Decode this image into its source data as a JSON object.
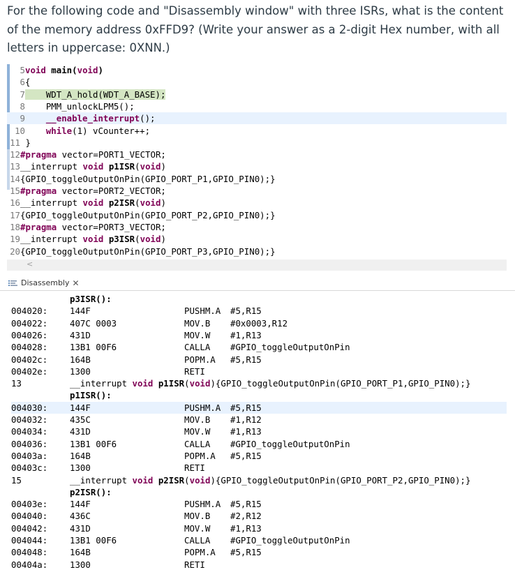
{
  "question": "For the following code and \"Disassembly window\" with three ISRs, what is the content of the memory address 0xFFD9? (Write your answer as a 2-digit Hex number, with all letters in uppercase: 0XNN.)",
  "editor": {
    "lines": [
      {
        "num": "5",
        "segments": [
          {
            "t": "void",
            "k": true
          },
          {
            "t": " main(",
            "k": false,
            "b": true
          },
          {
            "t": "void",
            "k": true
          },
          {
            "t": ")",
            "k": false,
            "b": true
          }
        ],
        "hl": ""
      },
      {
        "num": "6",
        "segments": [
          {
            "t": "{",
            "k": false
          }
        ],
        "hl": ""
      },
      {
        "num": "7",
        "segments": [
          {
            "t": "    WDT_A_hold(WDT_A_BASE);",
            "k": false,
            "hlspan": true
          }
        ],
        "hl": "green"
      },
      {
        "num": "8",
        "segments": [
          {
            "t": "    PMM_unlockLPM5();",
            "k": false
          }
        ],
        "hl": ""
      },
      {
        "num": "9",
        "segments": [
          {
            "t": "    ",
            "k": false
          },
          {
            "t": "__enable_interrupt",
            "k": true
          },
          {
            "t": "();",
            "k": false
          }
        ],
        "hl": "blue"
      },
      {
        "num": "10",
        "segments": [
          {
            "t": "    ",
            "k": false
          },
          {
            "t": "while",
            "k": true
          },
          {
            "t": "(1) vCounter++;",
            "k": false
          }
        ],
        "hl": ""
      },
      {
        "num": "11",
        "segments": [
          {
            "t": " }",
            "k": false
          }
        ],
        "hl": ""
      },
      {
        "num": "12",
        "segments": [
          {
            "t": "#pragma",
            "k": true
          },
          {
            "t": " vector=PORT1_VECTOR;",
            "k": false
          }
        ],
        "hl": ""
      },
      {
        "num": "13",
        "segments": [
          {
            "t": "__interrupt ",
            "k": false
          },
          {
            "t": "void",
            "k": true
          },
          {
            "t": " ",
            "k": false
          },
          {
            "t": "p1ISR",
            "k": false,
            "b": true
          },
          {
            "t": "(",
            "k": false
          },
          {
            "t": "void",
            "k": true
          },
          {
            "t": ")",
            "k": false
          }
        ],
        "hl": ""
      },
      {
        "num": "14",
        "segments": [
          {
            "t": "{GPIO_toggleOutputOnPin(GPIO_PORT_P1,GPIO_PIN0);}",
            "k": false
          }
        ],
        "hl": ""
      },
      {
        "num": "15",
        "segments": [
          {
            "t": "#pragma",
            "k": true
          },
          {
            "t": " vector=PORT2_VECTOR;",
            "k": false
          }
        ],
        "hl": ""
      },
      {
        "num": "16",
        "segments": [
          {
            "t": "__interrupt ",
            "k": false
          },
          {
            "t": "void",
            "k": true
          },
          {
            "t": " ",
            "k": false
          },
          {
            "t": "p2ISR",
            "k": false,
            "b": true
          },
          {
            "t": "(",
            "k": false
          },
          {
            "t": "void",
            "k": true
          },
          {
            "t": ")",
            "k": false
          }
        ],
        "hl": ""
      },
      {
        "num": "17",
        "segments": [
          {
            "t": "{GPIO_toggleOutputOnPin(GPIO_PORT_P2,GPIO_PIN0);}",
            "k": false
          }
        ],
        "hl": ""
      },
      {
        "num": "18",
        "segments": [
          {
            "t": "#pragma",
            "k": true
          },
          {
            "t": " vector=PORT3_VECTOR;",
            "k": false
          }
        ],
        "hl": ""
      },
      {
        "num": "19",
        "segments": [
          {
            "t": "__interrupt ",
            "k": false
          },
          {
            "t": "void",
            "k": true
          },
          {
            "t": " ",
            "k": false
          },
          {
            "t": "p3ISR",
            "k": false,
            "b": true
          },
          {
            "t": "(",
            "k": false
          },
          {
            "t": "void",
            "k": true
          },
          {
            "t": ")",
            "k": false
          }
        ],
        "hl": ""
      },
      {
        "num": "20",
        "segments": [
          {
            "t": "{GPIO_toggleOutputOnPin(GPIO_PORT_P3,GPIO_PIN0);}",
            "k": false
          }
        ],
        "hl": ""
      }
    ],
    "scroll_left": "<"
  },
  "tab": {
    "label": "Disassembly",
    "close": "✕",
    "icon": "disassembly-icon"
  },
  "disassembly": [
    {
      "kind": "label",
      "text": "p3ISR():"
    },
    {
      "kind": "instr",
      "addr": "004020:",
      "op": "144F",
      "mn": "PUSHM.A",
      "args": "#5,R15"
    },
    {
      "kind": "instr",
      "addr": "004022:",
      "op": "407C 0003",
      "mn": "MOV.B",
      "args": "#0x0003,R12"
    },
    {
      "kind": "instr",
      "addr": "004026:",
      "op": "431D",
      "mn": "MOV.W",
      "args": "#1,R13"
    },
    {
      "kind": "instr",
      "addr": "004028:",
      "op": "13B1 00F6",
      "mn": "CALLA",
      "args": "#GPIO_toggleOutputOnPin"
    },
    {
      "kind": "instr",
      "addr": "00402c:",
      "op": "164B",
      "mn": "POPM.A",
      "args": "#5,R15"
    },
    {
      "kind": "instr",
      "addr": "00402e:",
      "op": "1300",
      "mn": "RETI",
      "args": ""
    },
    {
      "kind": "src",
      "addr": "13",
      "pre": "__interrupt ",
      "kw1": "void",
      "mid": " ",
      "name": "p1ISR",
      "open": "(",
      "kw2": "void",
      "post": "){GPIO_toggleOutputOnPin(GPIO_PORT_P1,GPIO_PIN0);}"
    },
    {
      "kind": "label",
      "text": "p1ISR():"
    },
    {
      "kind": "instr",
      "addr": "004030:",
      "op": "144F",
      "mn": "PUSHM.A",
      "args": "#5,R15",
      "hl": true
    },
    {
      "kind": "instr",
      "addr": "004032:",
      "op": "435C",
      "mn": "MOV.B",
      "args": "#1,R12"
    },
    {
      "kind": "instr",
      "addr": "004034:",
      "op": "431D",
      "mn": "MOV.W",
      "args": "#1,R13"
    },
    {
      "kind": "instr",
      "addr": "004036:",
      "op": "13B1 00F6",
      "mn": "CALLA",
      "args": "#GPIO_toggleOutputOnPin"
    },
    {
      "kind": "instr",
      "addr": "00403a:",
      "op": "164B",
      "mn": "POPM.A",
      "args": "#5,R15"
    },
    {
      "kind": "instr",
      "addr": "00403c:",
      "op": "1300",
      "mn": "RETI",
      "args": ""
    },
    {
      "kind": "src",
      "addr": "15",
      "pre": "__interrupt ",
      "kw1": "void",
      "mid": " ",
      "name": "p2ISR",
      "open": "(",
      "kw2": "void",
      "post": "){GPIO_toggleOutputOnPin(GPIO_PORT_P2,GPIO_PIN0);}"
    },
    {
      "kind": "label",
      "text": "p2ISR():"
    },
    {
      "kind": "instr",
      "addr": "00403e:",
      "op": "144F",
      "mn": "PUSHM.A",
      "args": "#5,R15"
    },
    {
      "kind": "instr",
      "addr": "004040:",
      "op": "436C",
      "mn": "MOV.B",
      "args": "#2,R12"
    },
    {
      "kind": "instr",
      "addr": "004042:",
      "op": "431D",
      "mn": "MOV.W",
      "args": "#1,R13"
    },
    {
      "kind": "instr",
      "addr": "004044:",
      "op": "13B1 00F6",
      "mn": "CALLA",
      "args": "#GPIO_toggleOutputOnPin"
    },
    {
      "kind": "instr",
      "addr": "004048:",
      "op": "164B",
      "mn": "POPM.A",
      "args": "#5,R15"
    },
    {
      "kind": "instr",
      "addr": "00404a:",
      "op": "1300",
      "mn": "RETI",
      "args": ""
    }
  ]
}
